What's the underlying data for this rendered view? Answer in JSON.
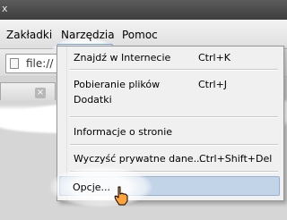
{
  "window": {
    "title_fragment": "x"
  },
  "menubar": {
    "items": [
      {
        "label": "Zakładki"
      },
      {
        "label": "Narzędzia"
      },
      {
        "label": "Pomoc"
      }
    ]
  },
  "toolbar": {
    "address_value": "file://"
  },
  "tab": {
    "close_glyph": "×"
  },
  "dropdown": {
    "items": [
      {
        "label": "Znajdź w Internecie",
        "shortcut": "Ctrl+K"
      },
      {
        "label": "Pobieranie plików",
        "shortcut": "Ctrl+J"
      },
      {
        "label": "Dodatki",
        "shortcut": ""
      },
      {
        "label": "Informacje o stronie",
        "shortcut": ""
      },
      {
        "label": "Wyczyść prywatne dane...",
        "shortcut": "Ctrl+Shift+Del"
      },
      {
        "label": "Opcje...",
        "shortcut": ""
      }
    ],
    "highlighted_index": 5
  },
  "colors": {
    "menu_highlight": "#c2d4e8",
    "dropdown_bg": "#f0f0f0"
  }
}
